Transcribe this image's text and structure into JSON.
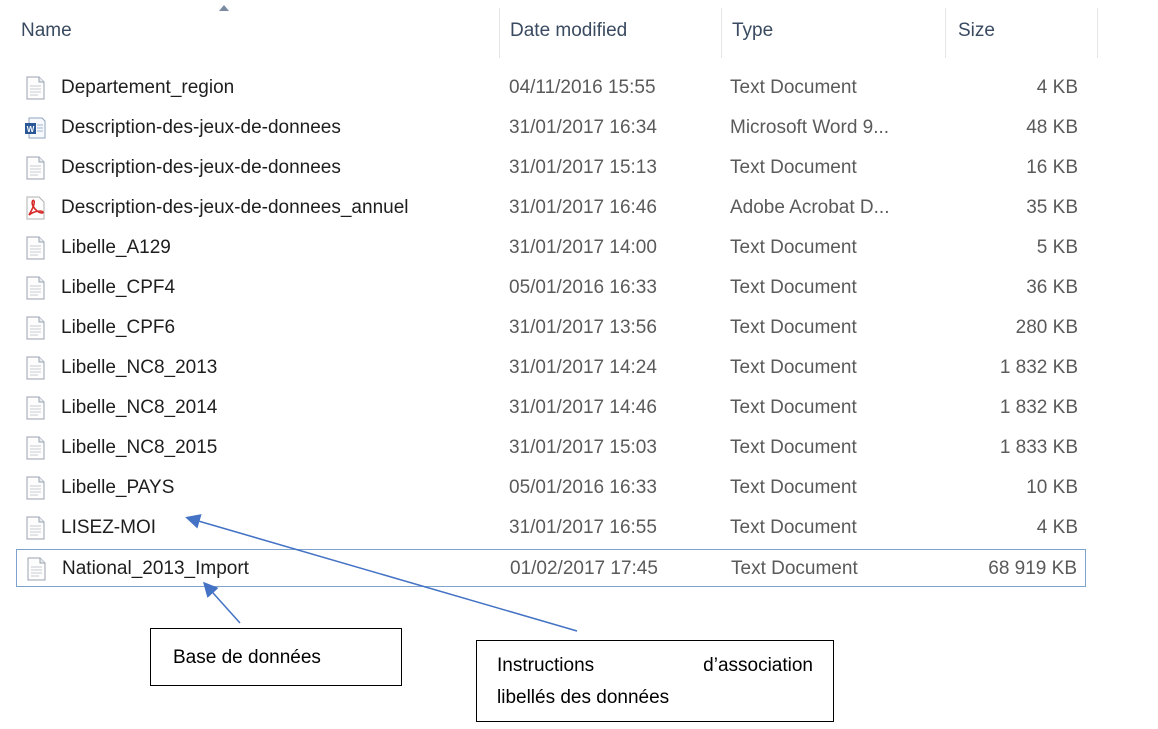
{
  "columns": {
    "name": "Name",
    "date": "Date modified",
    "type": "Type",
    "size": "Size"
  },
  "files": [
    {
      "name": "Departement_region",
      "date": "04/11/2016 15:55",
      "type": "Text Document",
      "size": "4 KB",
      "icon": "text-file-icon"
    },
    {
      "name": "Description-des-jeux-de-donnees",
      "date": "31/01/2017 16:34",
      "type": "Microsoft Word 9...",
      "size": "48 KB",
      "icon": "word-file-icon"
    },
    {
      "name": "Description-des-jeux-de-donnees",
      "date": "31/01/2017 15:13",
      "type": "Text Document",
      "size": "16 KB",
      "icon": "text-file-icon"
    },
    {
      "name": "Description-des-jeux-de-donnees_annuel",
      "date": "31/01/2017 16:46",
      "type": "Adobe Acrobat D...",
      "size": "35 KB",
      "icon": "pdf-file-icon"
    },
    {
      "name": "Libelle_A129",
      "date": "31/01/2017 14:00",
      "type": "Text Document",
      "size": "5 KB",
      "icon": "text-file-icon"
    },
    {
      "name": "Libelle_CPF4",
      "date": "05/01/2016 16:33",
      "type": "Text Document",
      "size": "36 KB",
      "icon": "text-file-icon"
    },
    {
      "name": "Libelle_CPF6",
      "date": "31/01/2017 13:56",
      "type": "Text Document",
      "size": "280 KB",
      "icon": "text-file-icon"
    },
    {
      "name": "Libelle_NC8_2013",
      "date": "31/01/2017 14:24",
      "type": "Text Document",
      "size": "1 832 KB",
      "icon": "text-file-icon"
    },
    {
      "name": "Libelle_NC8_2014",
      "date": "31/01/2017 14:46",
      "type": "Text Document",
      "size": "1 832 KB",
      "icon": "text-file-icon"
    },
    {
      "name": "Libelle_NC8_2015",
      "date": "31/01/2017 15:03",
      "type": "Text Document",
      "size": "1 833 KB",
      "icon": "text-file-icon"
    },
    {
      "name": "Libelle_PAYS",
      "date": "05/01/2016 16:33",
      "type": "Text Document",
      "size": "10 KB",
      "icon": "text-file-icon"
    },
    {
      "name": "LISEZ-MOI",
      "date": "31/01/2017 16:55",
      "type": "Text Document",
      "size": "4 KB",
      "icon": "text-file-icon"
    },
    {
      "name": "National_2013_Import",
      "date": "01/02/2017 17:45",
      "type": "Text Document",
      "size": "68 919 KB",
      "icon": "text-file-icon",
      "selected": true
    }
  ],
  "annotations": {
    "database": "Base de données",
    "instructions_word1": "Instructions",
    "instructions_word2": "d’association",
    "instructions_line2": "libellés des données"
  }
}
